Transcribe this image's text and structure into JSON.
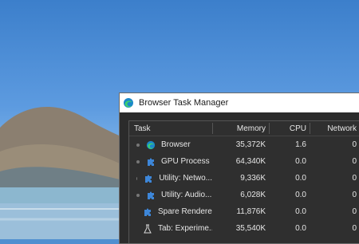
{
  "window": {
    "title": "Browser Task Manager"
  },
  "columns": {
    "task": "Task",
    "memory": "Memory",
    "cpu": "CPU",
    "network": "Network"
  },
  "rows": [
    {
      "name": "Browser",
      "memory": "35,372K",
      "cpu": "1.6",
      "network": "0",
      "icon": "edge-icon"
    },
    {
      "name": "GPU Process",
      "memory": "64,340K",
      "cpu": "0.0",
      "network": "0",
      "icon": "puzzle-icon"
    },
    {
      "name": "Utility: Netwo...",
      "memory": "9,336K",
      "cpu": "0.0",
      "network": "0",
      "icon": "puzzle-icon"
    },
    {
      "name": "Utility: Audio...",
      "memory": "6,028K",
      "cpu": "0.0",
      "network": "0",
      "icon": "puzzle-icon"
    },
    {
      "name": "Spare Renderer",
      "memory": "11,876K",
      "cpu": "0.0",
      "network": "0",
      "icon": "puzzle-icon"
    },
    {
      "name": "Tab: Experime...",
      "memory": "35,540K",
      "cpu": "0.0",
      "network": "0",
      "icon": "flask-icon"
    }
  ]
}
